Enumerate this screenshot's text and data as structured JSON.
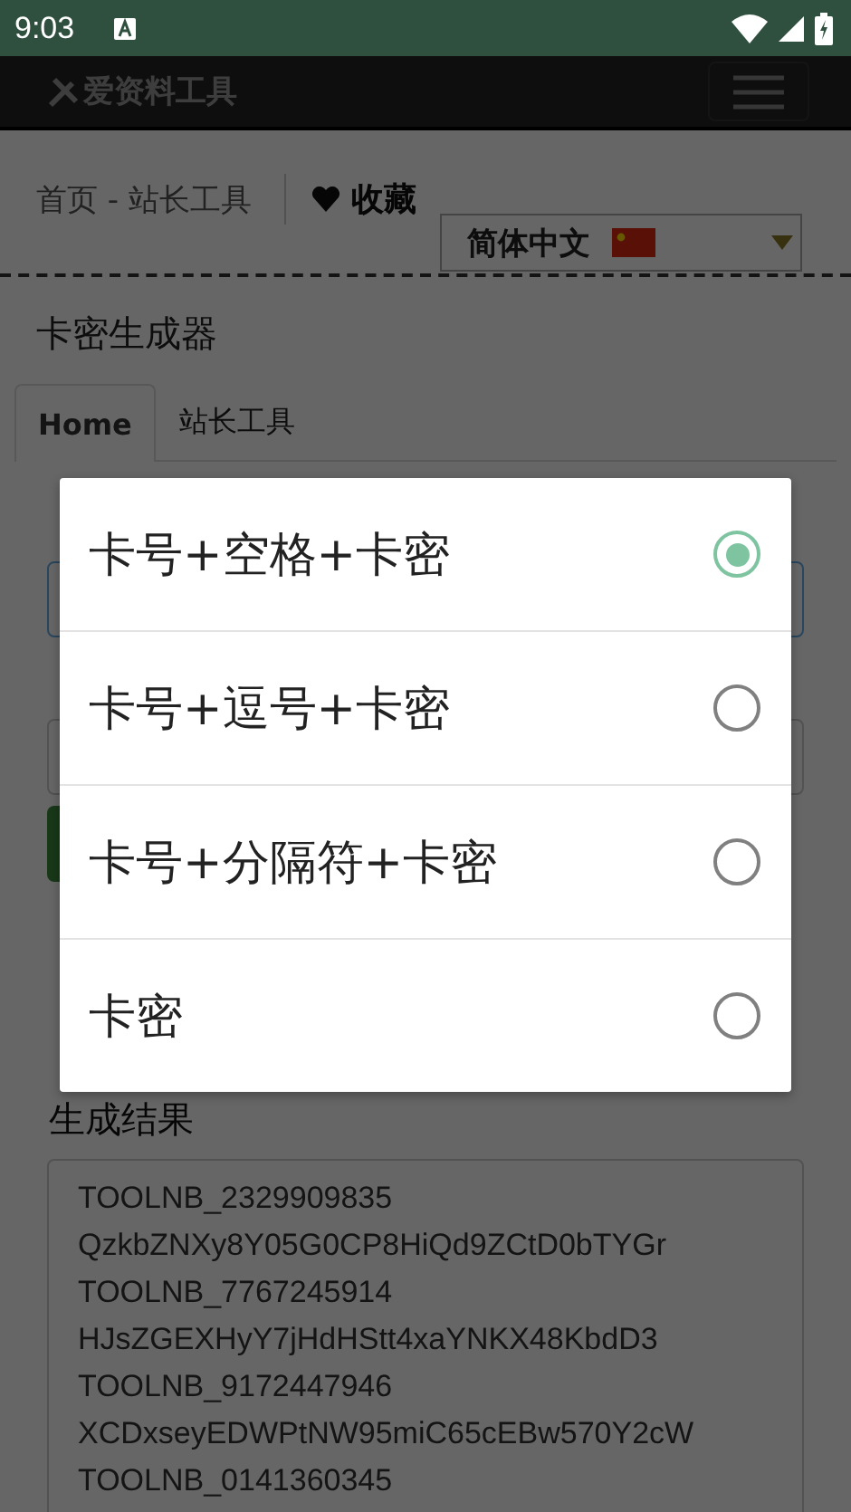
{
  "status_bar": {
    "time": "9:03"
  },
  "nav": {
    "logo": "爱资料工具"
  },
  "breadcrumb": {
    "path": "首页 - 站长工具",
    "favorite": "收藏"
  },
  "language": {
    "value": "简体中文"
  },
  "page_title": "卡密生成器",
  "tabs": [
    {
      "label": "Home",
      "selected": true
    },
    {
      "label": "站长工具",
      "selected": false
    }
  ],
  "dialog": {
    "options": [
      {
        "label": "卡号+空格+卡密",
        "selected": true
      },
      {
        "label": "卡号+逗号+卡密",
        "selected": false
      },
      {
        "label": "卡号+分隔符+卡密",
        "selected": false
      },
      {
        "label": "卡密",
        "selected": false
      }
    ]
  },
  "result": {
    "label": "生成结果",
    "lines": [
      "TOOLNB_2329909835",
      "QzkbZNXy8Y05G0CP8HiQd9ZCtD0bTYGr",
      "TOOLNB_7767245914",
      "HJsZGEXHyY7jHdHStt4xaYNKX48KbdD3",
      "TOOLNB_9172447946",
      "XCDxseyEDWPtNW95miC65cEBw570Y2cW",
      "TOOLNB_0141360345"
    ]
  }
}
